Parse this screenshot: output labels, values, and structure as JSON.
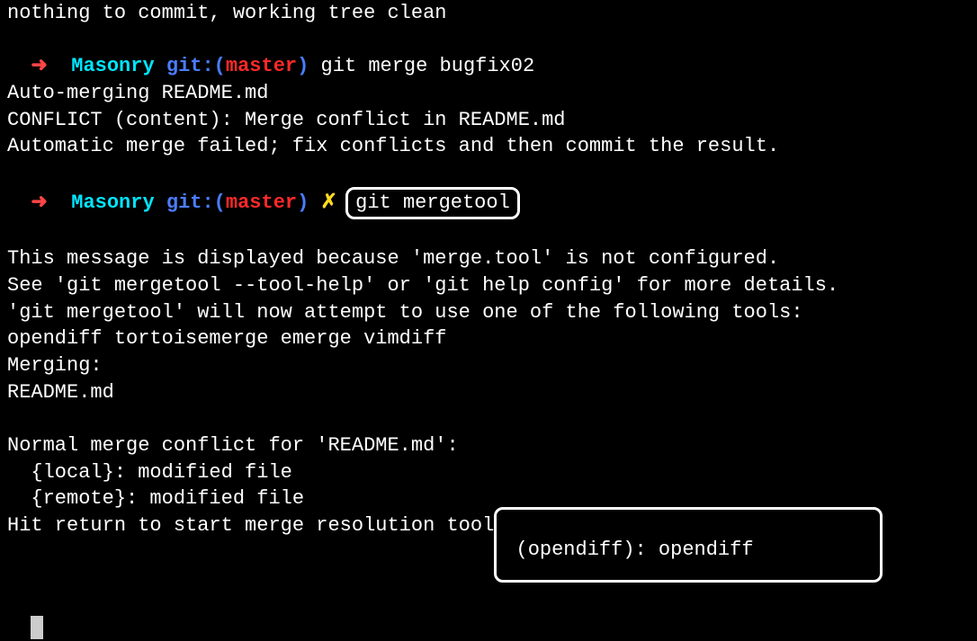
{
  "line0": "nothing to commit, working tree clean",
  "prompt1": {
    "arrow": "➜  ",
    "dir": "Masonry",
    "gitlabel": " git:(",
    "branch": "master",
    "gitclose": ") ",
    "cmd": "git merge bugfix02"
  },
  "line2": "Auto-merging README.md",
  "line3": "CONFLICT (content): Merge conflict in README.md",
  "line4": "Automatic merge failed; fix conflicts and then commit the result.",
  "prompt2": {
    "arrow": "➜  ",
    "dir": "Masonry",
    "gitlabel": " git:(",
    "branch": "master",
    "gitclose": ") ",
    "x": "✗ ",
    "cmd": "git mergetool"
  },
  "blank": " ",
  "line6": "This message is displayed because 'merge.tool' is not configured.",
  "line7": "See 'git mergetool --tool-help' or 'git help config' for more details.",
  "line8": "'git mergetool' will now attempt to use one of the following tools:",
  "line9": "opendiff tortoisemerge emerge vimdiff",
  "line10": "Merging:",
  "line11": "README.md",
  "line12": "Normal merge conflict for 'README.md':",
  "line13": "  {local}: modified file",
  "line14": "  {remote}: modified file",
  "line15a": "Hit return to start merge resolution tool",
  "line15b": " (opendiff): opendiff          "
}
